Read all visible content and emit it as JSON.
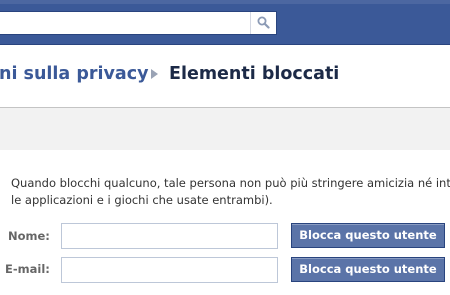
{
  "header": {
    "search": {
      "value": "",
      "placeholder": ""
    },
    "colors": {
      "bar": "#3b5998",
      "bar_border": "#29447e"
    }
  },
  "breadcrumb": {
    "previous": "ni sulla privacy",
    "separator_icon": "triangle-right-icon",
    "current": "Elementi bloccati"
  },
  "block_users": {
    "description": [
      "Quando blocchi qualcuno, tale persona non può più stringere amicizia né inte",
      "le applicazioni e i giochi che usate entrambi)."
    ],
    "name_row": {
      "label": "Nome:",
      "value": "",
      "button": "Blocca questo utente"
    },
    "email_row": {
      "label": "E-mail:",
      "value": "",
      "button": "Blocca questo utente"
    }
  },
  "colors": {
    "button": "#5b74a8",
    "link": "#3b5998",
    "heading": "#1c2a47"
  }
}
